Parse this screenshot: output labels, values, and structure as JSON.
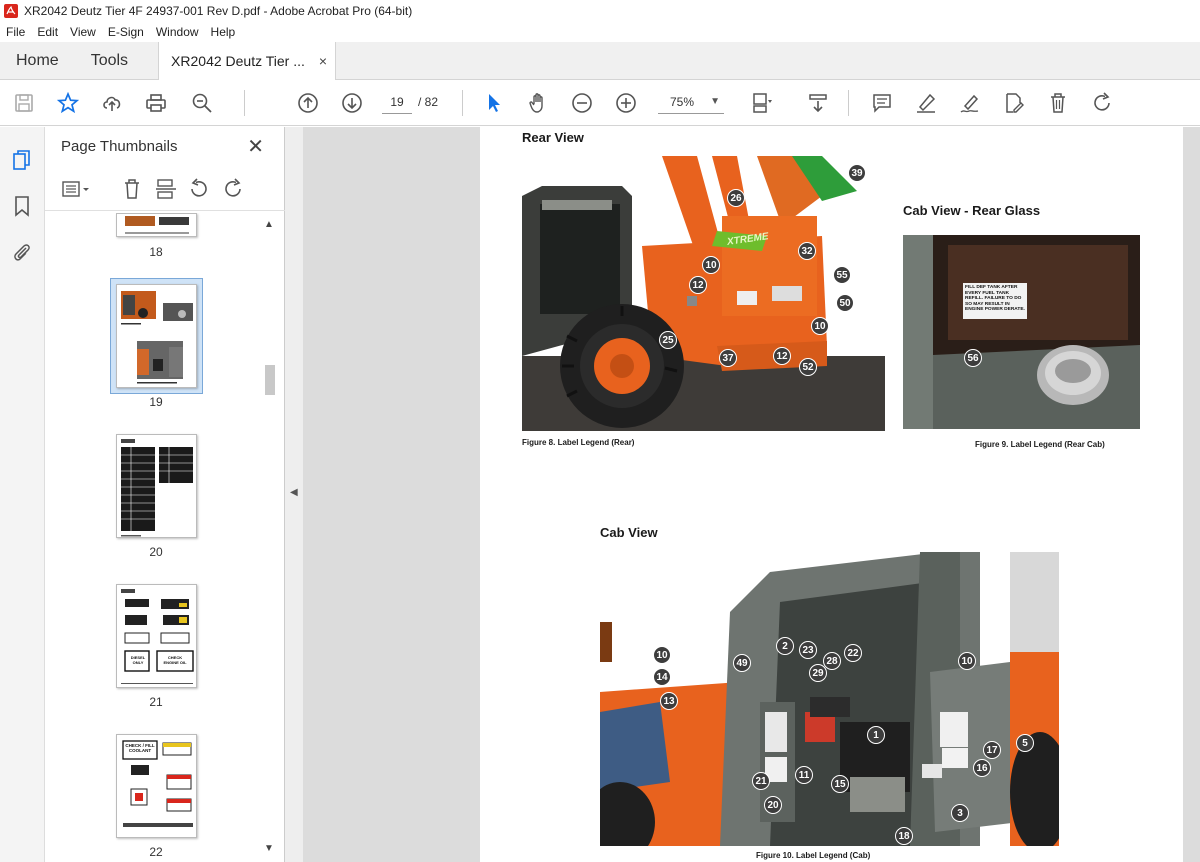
{
  "window": {
    "title": "XR2042 Deutz Tier 4F 24937-001 Rev D.pdf - Adobe Acrobat Pro (64-bit)"
  },
  "menu": [
    "File",
    "Edit",
    "View",
    "E-Sign",
    "Window",
    "Help"
  ],
  "tabs": {
    "home": "Home",
    "tools": "Tools",
    "document": "XR2042 Deutz Tier ...",
    "close_glyph": "×"
  },
  "toolbar": {
    "current_page": "19",
    "page_total": "/  82",
    "zoom": "75%",
    "icons": [
      "save-icon",
      "star-icon",
      "upload-icon",
      "print-icon",
      "zoom-out-search-icon",
      "page-up-icon",
      "page-down-icon",
      "select-cursor-icon",
      "hand-icon",
      "zoom-out-icon",
      "zoom-in-icon",
      "page-layout-icon",
      "scroll-mode-icon",
      "comment-icon",
      "highlight-icon",
      "sign-icon",
      "edit-pdf-icon",
      "delete-icon",
      "rotate-icon"
    ]
  },
  "thumbnail_panel": {
    "title": "Page Thumbnails",
    "close_glyph": "✕",
    "page_labels": [
      "18",
      "19",
      "20",
      "21",
      "22"
    ],
    "selected_page": "19",
    "thumb21_labels": [
      "DIESEL ONLY",
      "CHECK ENGINE OIL"
    ],
    "thumb22_labels": [
      "CHECK / FILL COOLANT"
    ]
  },
  "document": {
    "rear_view_heading": "Rear View",
    "cab_rear_glass_heading": "Cab View - Rear Glass",
    "cab_view_heading": "Cab View",
    "figure8_caption": "Figure 8. Label Legend (Rear)",
    "figure9_caption": "Figure 9. Label Legend (Rear Cab)",
    "figure10_caption": "Figure 10. Label Legend (Cab)",
    "rear_callouts": [
      "39",
      "26",
      "32",
      "10",
      "55",
      "12",
      "50",
      "10",
      "25",
      "37",
      "12",
      "52"
    ],
    "rear_cab_callouts": [
      "56"
    ],
    "rear_cab_sticker": "FILL DEF TANK AFTER EVERY FUEL TANK REFILL. FAILURE TO DO SO MAY RESULT IN ENGINE POWER DERATE.",
    "cab_callouts": [
      "10",
      "14",
      "13",
      "2",
      "23",
      "28",
      "22",
      "29",
      "49",
      "10",
      "1",
      "5",
      "17",
      "16",
      "21",
      "11",
      "15",
      "20",
      "3",
      "18"
    ],
    "machine_brand": "XTREME"
  },
  "colors": {
    "accent_blue": "#1473e6",
    "machine_orange": "#e8621e",
    "cab_grey": "#6e7470"
  }
}
